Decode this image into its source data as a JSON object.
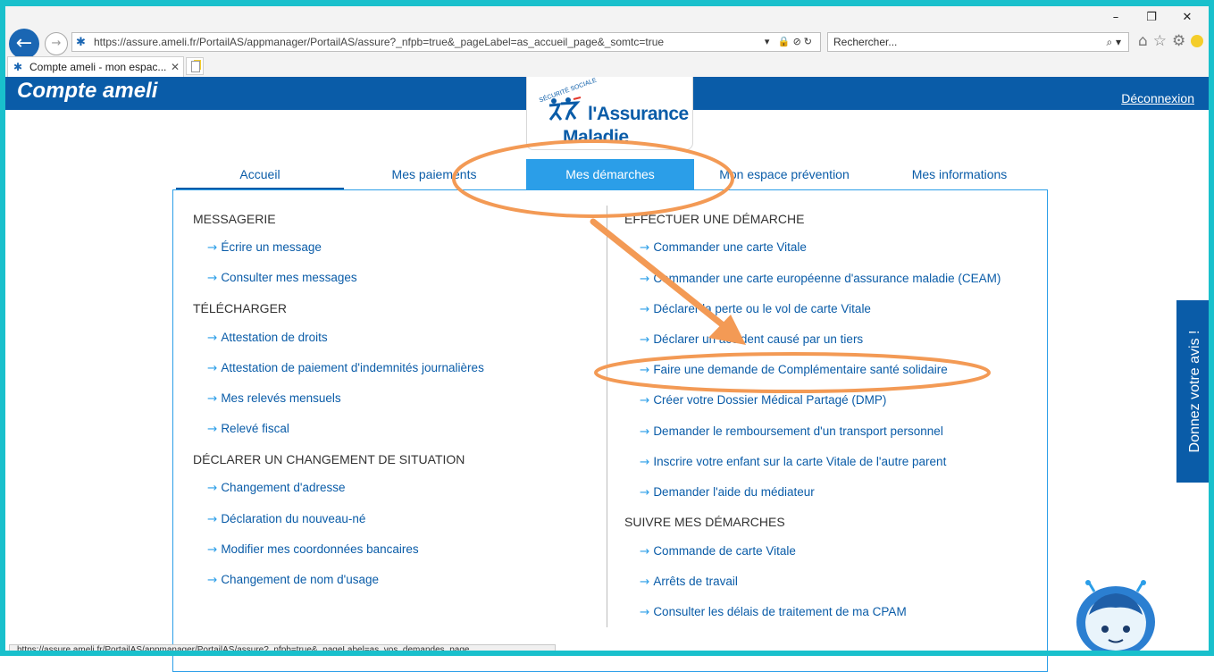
{
  "window_controls": {
    "minimize": "–",
    "restore": "❐",
    "close": "✕"
  },
  "browser": {
    "url": "https://assure.ameli.fr/PortailAS/appmanager/PortailAS/assure?_nfpb=true&_pageLabel=as_accueil_page&_somtc=true",
    "search_placeholder": "Rechercher...",
    "tab_title": "Compte ameli - mon espac...",
    "status_url": "https://assure.ameli.fr/PortailAS/appmanager/PortailAS/assure?_nfpb=true&_pageLabel=as_vos_demandes_page"
  },
  "header": {
    "brand": "Compte ameli",
    "logout": "Déconnexion",
    "logo_line1": "l'Assurance",
    "logo_line2": "Maladie",
    "logo_seal": "SÉCURITÉ SOCIALE"
  },
  "nav": {
    "tabs": [
      {
        "label": "Accueil"
      },
      {
        "label": "Mes paiements"
      },
      {
        "label": "Mes démarches"
      },
      {
        "label": "Mon espace prévention"
      },
      {
        "label": "Mes informations"
      }
    ]
  },
  "left": {
    "messagerie": {
      "title": "MESSAGERIE",
      "items": [
        "Écrire un message",
        "Consulter mes messages"
      ]
    },
    "telecharger": {
      "title": "TÉLÉCHARGER",
      "items": [
        "Attestation de droits",
        "Attestation de paiement d'indemnités journalières",
        "Mes relevés mensuels",
        "Relevé fiscal"
      ]
    },
    "situation": {
      "title": "DÉCLARER UN CHANGEMENT DE SITUATION",
      "items": [
        "Changement d'adresse",
        "Déclaration du nouveau-né",
        "Modifier mes coordonnées bancaires",
        "Changement de nom d'usage"
      ]
    }
  },
  "right": {
    "effectuer": {
      "title": "EFFECTUER UNE DÉMARCHE",
      "items": [
        "Commander une carte Vitale",
        "Commander une carte européenne d'assurance maladie (CEAM)",
        "Déclarer la perte ou le vol de carte Vitale",
        "Déclarer un accident causé par un tiers",
        "Faire une demande de Complémentaire santé solidaire",
        "Créer votre Dossier Médical Partagé (DMP)",
        "Demander le remboursement d'un transport personnel",
        "Inscrire votre enfant sur la carte Vitale de l'autre parent",
        "Demander l'aide du médiateur"
      ]
    },
    "suivre": {
      "title": "SUIVRE MES DÉMARCHES",
      "items": [
        "Commande de carte Vitale",
        "Arrêts de travail",
        "Consulter les délais de traitement de ma CPAM"
      ]
    }
  },
  "feedback_label": "Donnez votre avis !",
  "colors": {
    "brand_blue": "#0a5ca8",
    "accent_blue": "#2b9ee8",
    "annotation_orange": "#f39a55",
    "frame_cyan": "#19c0cc"
  }
}
